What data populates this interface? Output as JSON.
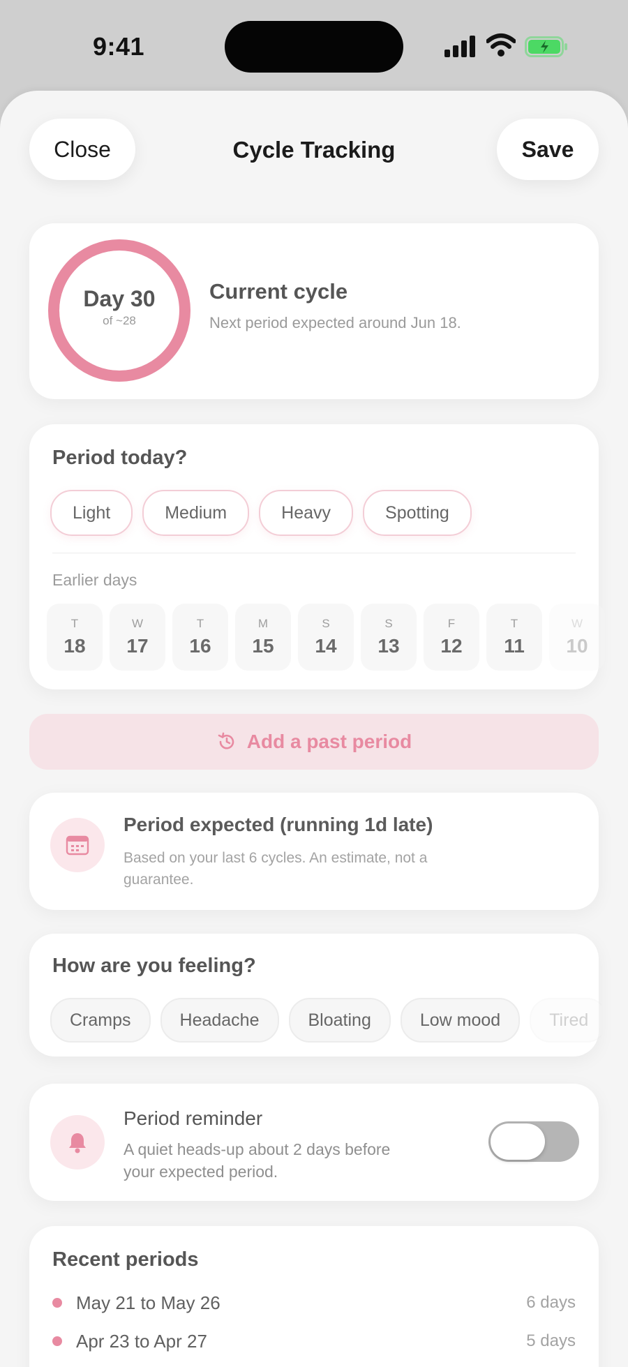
{
  "status_bar": {
    "time": "9:41"
  },
  "header": {
    "close_label": "Close",
    "title": "Cycle Tracking",
    "save_label": "Save"
  },
  "cycle": {
    "day": "Day 30",
    "of": "of ~28",
    "progress": 1.0,
    "title": "Current cycle",
    "subtitle": "Next period expected around Jun 18.",
    "ring_color": "#e88aa1"
  },
  "period_today": {
    "heading": "Period today?",
    "options": [
      "Light",
      "Medium",
      "Heavy",
      "Spotting"
    ],
    "earlier_label": "Earlier days",
    "days": [
      {
        "dow": "T",
        "num": "18"
      },
      {
        "dow": "W",
        "num": "17"
      },
      {
        "dow": "T",
        "num": "16"
      },
      {
        "dow": "M",
        "num": "15"
      },
      {
        "dow": "S",
        "num": "14"
      },
      {
        "dow": "S",
        "num": "13"
      },
      {
        "dow": "F",
        "num": "12"
      },
      {
        "dow": "T",
        "num": "11"
      },
      {
        "dow": "W",
        "num": "10"
      }
    ]
  },
  "add_past": {
    "label": "Add a past period",
    "icon": "history-icon"
  },
  "expected": {
    "icon": "calendar-icon",
    "title": "Period expected (running 1d late)",
    "subtitle": "Based on your last 6 cycles. An estimate, not a guarantee."
  },
  "feeling": {
    "heading": "How are you feeling?",
    "symptoms": [
      "Cramps",
      "Headache",
      "Bloating",
      "Low mood",
      "Tired"
    ]
  },
  "reminder": {
    "icon": "bell-icon",
    "title": "Period reminder",
    "subtitle": "A quiet heads-up about 2 days before your expected period.",
    "enabled": false
  },
  "recent": {
    "heading": "Recent periods",
    "items": [
      {
        "range": "May 21 to May 26",
        "length": "6 days"
      },
      {
        "range": "Apr 23 to Apr 27",
        "length": "5 days"
      }
    ]
  }
}
